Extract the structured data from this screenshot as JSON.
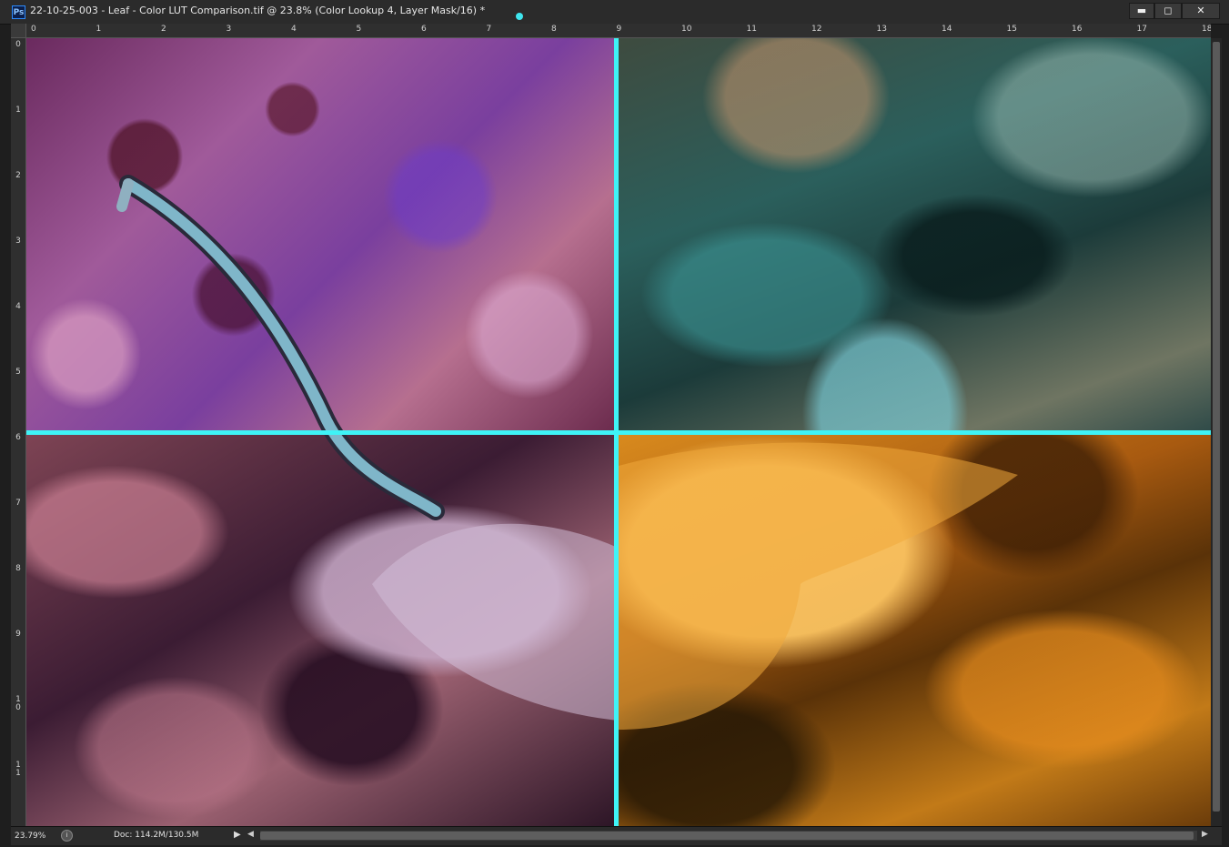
{
  "window": {
    "app_badge": "Ps",
    "title": "22-10-25-003 - Leaf - Color LUT Comparison.tif @ 23.8%  (Color Lookup 4, Layer Mask/16) *",
    "minimize_glyph": "▬",
    "maximize_glyph": "◻",
    "close_glyph": "✕"
  },
  "rulers": {
    "horizontal": [
      "0",
      "1",
      "2",
      "3",
      "4",
      "5",
      "6",
      "7",
      "8",
      "9",
      "10",
      "11",
      "12",
      "13",
      "14",
      "15",
      "16",
      "17",
      "18"
    ],
    "vertical": [
      "0",
      "1",
      "2",
      "3",
      "4",
      "5",
      "6",
      "7",
      "8",
      "9",
      "10",
      "11",
      "1"
    ]
  },
  "canvas": {
    "guide_color": "#3ff3f6",
    "quadrants": [
      {
        "name": "top-left",
        "tint": "purple-magenta"
      },
      {
        "name": "top-right",
        "tint": "teal-cyan"
      },
      {
        "name": "bottom-left",
        "tint": "rose-plum"
      },
      {
        "name": "bottom-right",
        "tint": "orange-amber"
      }
    ]
  },
  "status": {
    "zoom": "23.79%",
    "doc_info": "Doc: 114.2M/130.5M",
    "menu_arrow": "▶",
    "scroll_left": "◀",
    "scroll_right": "▶"
  },
  "icons": [
    "photoshop-logo-icon",
    "status-info-icon",
    "menu-arrow-icon",
    "scroll-left-icon",
    "scroll-right-icon"
  ]
}
